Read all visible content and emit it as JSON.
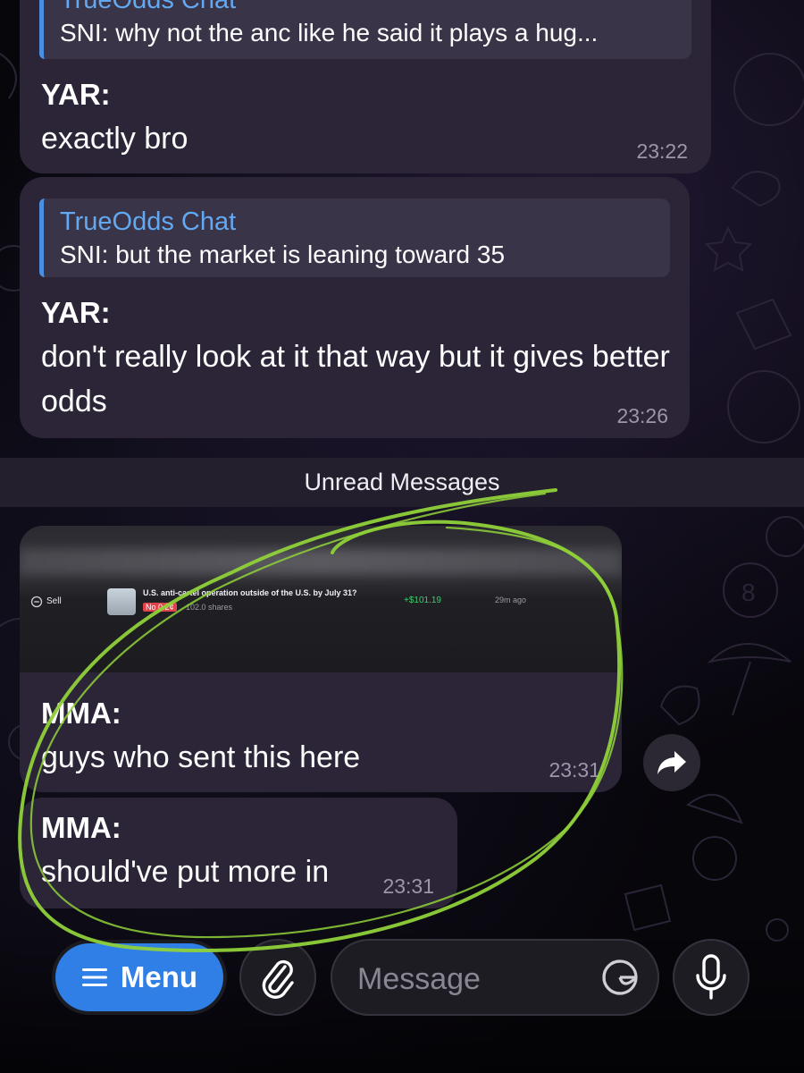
{
  "messages": [
    {
      "reply": {
        "title": "TrueOdds Chat",
        "text": "SNI: why not the anc like he said it plays a hug..."
      },
      "sender": "YAR:",
      "text": "exactly bro",
      "time": "23:22"
    },
    {
      "reply": {
        "title": "TrueOdds Chat",
        "text": "SNI: but the market is leaning toward 35"
      },
      "sender": "YAR:",
      "text": "don't really look at it that way but it gives better odds",
      "time": "23:26"
    },
    {
      "screenshot": {
        "action": "Sell",
        "market": "U.S. anti-cartel operation outside of the U.S. by July 31?",
        "outcome": "No 0.2¢",
        "shares": "102.0 shares",
        "profit": "+$101.19",
        "ago": "29m ago"
      },
      "sender": "MMA:",
      "text": "guys who sent this here",
      "time": "23:31"
    },
    {
      "sender": "MMA:",
      "text": "should've put more in",
      "time": "23:31"
    }
  ],
  "unread_divider": "Unread Messages",
  "composer": {
    "menu_label": "Menu",
    "placeholder": "Message"
  },
  "icons": {
    "menu": "hamburger-icon",
    "attach": "paperclip-icon",
    "sticker": "sticker-icon",
    "mic": "microphone-icon",
    "forward": "forward-arrow-icon",
    "sell": "minus-circle-icon"
  },
  "colors": {
    "accent": "#2f7fe6",
    "reply_title": "#62a8f2",
    "bubble": "#2c2538",
    "annotation": "#8fd13a",
    "profit": "#3ecf6e",
    "no_badge": "#e0434b"
  }
}
